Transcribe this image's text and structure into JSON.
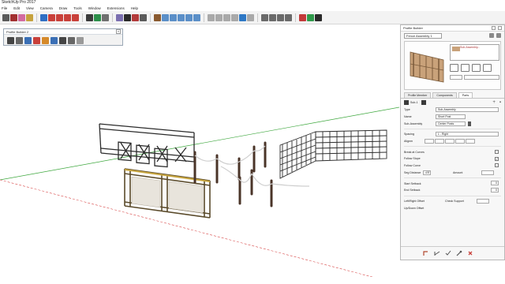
{
  "window": {
    "title": "SketchUp Pro 2017"
  },
  "menu": [
    "File",
    "Edit",
    "View",
    "Camera",
    "Draw",
    "Tools",
    "Window",
    "Extensions",
    "Help"
  ],
  "floating_toolbar": {
    "title": "Profile Builder 2",
    "close": "×"
  },
  "tray": {
    "title": "Profile Builder",
    "assembly_name": "Fence Assembly 1",
    "variant_label": "Sub-Assembly...",
    "tabs": [
      "Profile Member",
      "Components",
      "Parts"
    ],
    "active_tab": "Parts",
    "part_label": "Sub-1",
    "fields": {
      "type_label": "Type",
      "type_value": "Sub-Assembly",
      "name_label": "Name",
      "name_value": "Short Post",
      "subassembly_label": "Sub-Assembly",
      "subassembly_value": "Center Posts",
      "spacing_label": "Spacing",
      "spacing_value": "L - Right",
      "align_label": "Alignm",
      "snap_label": "Break at Curves",
      "follow_slope_label": "Follow Slope",
      "follow_curve_label": "Follow Curve",
      "seg_distance_label": "Seg Distance",
      "seg_distance_value": "4'8\"",
      "seg_amount_label": "Amount",
      "start_setback_label": "Start Setback",
      "start_setback_value": "0",
      "end_setback_label": "End Setback",
      "end_setback_value": "0",
      "left_right_offset_label": "Left/Right Offset",
      "check_support_label": "Check Support",
      "up_down_offset_label": "Up/Down Offset",
      "follow_slope_checked": "✓",
      "follow_curve_checked": ""
    }
  },
  "colors": {
    "toolbar_bg": "#f3f3f3",
    "axis_red": "#d84a4a",
    "axis_green": "#3ea83e",
    "fence_dark": "#2b2b2b",
    "fence_brown": "#5a4a2a",
    "post_brown": "#4a3428",
    "tray_bg": "#f7f7f7"
  },
  "icons": [
    "pencil-icon",
    "arc-icon",
    "eraser-icon",
    "paint-bucket-icon",
    "move-icon",
    "rotate-icon",
    "scale-icon",
    "push-pull-icon",
    "offset-icon",
    "tape-measure-icon",
    "text-icon",
    "orbit-icon",
    "pan-icon",
    "zoom-icon",
    "zoom-extents-icon",
    "iso-view-icon",
    "top-view-icon",
    "front-view-icon",
    "right-view-icon",
    "xray-icon",
    "wireframe-icon",
    "hidden-line-icon",
    "shaded-icon",
    "textured-icon",
    "warehouse-icon",
    "extension-manager-icon",
    "profile-builder-icon"
  ]
}
